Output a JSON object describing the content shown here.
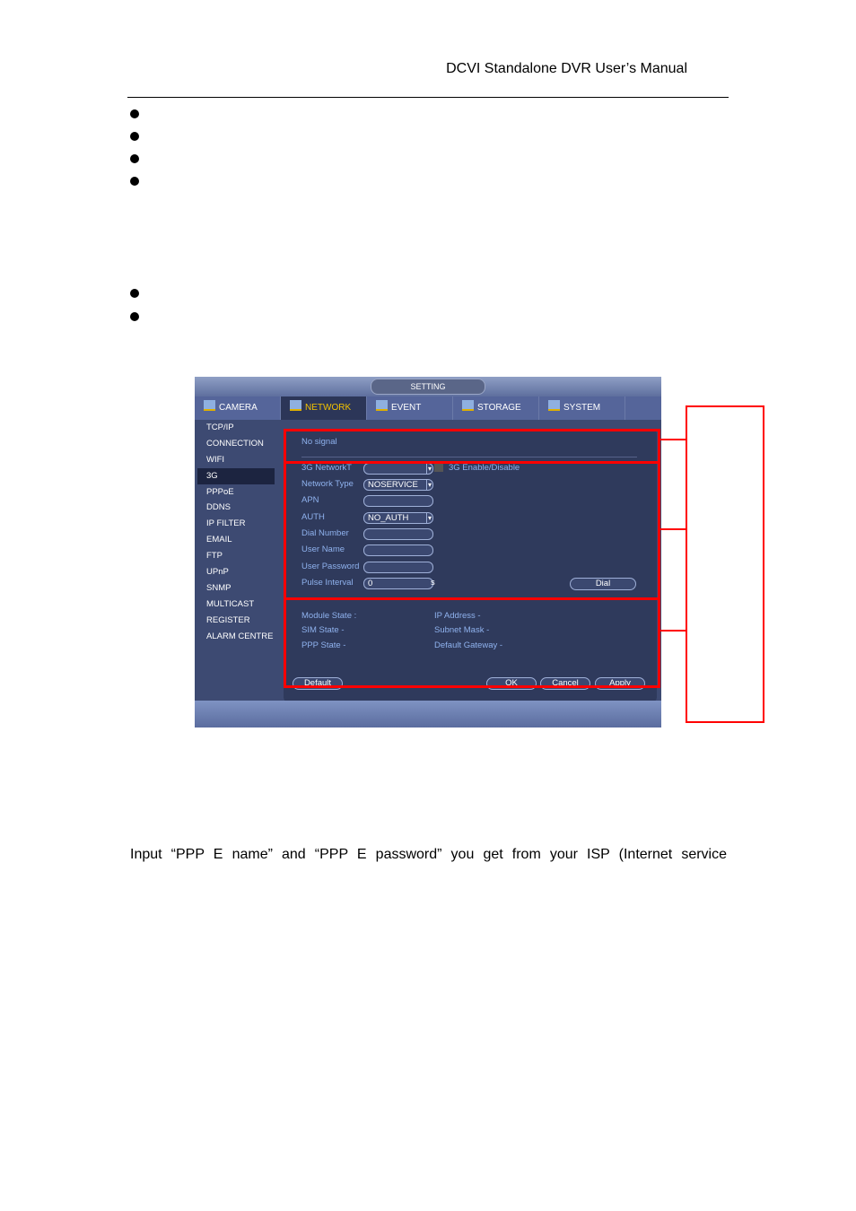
{
  "header": {
    "title": "DCVI Standalone DVR User’s Manual"
  },
  "dvr": {
    "title": "SETTING",
    "tabs": [
      {
        "label": "CAMERA",
        "icon": "camera-icon"
      },
      {
        "label": "NETWORK",
        "icon": "network-icon"
      },
      {
        "label": "EVENT",
        "icon": "event-icon"
      },
      {
        "label": "STORAGE",
        "icon": "storage-icon"
      },
      {
        "label": "SYSTEM",
        "icon": "system-icon"
      }
    ],
    "active_tab": "NETWORK",
    "sidebar": [
      "TCP/IP",
      "CONNECTION",
      "WIFI",
      "3G",
      "PPPoE",
      "DDNS",
      "IP FILTER",
      "EMAIL",
      "FTP",
      "UPnP",
      "SNMP",
      "MULTICAST",
      "REGISTER",
      "ALARM CENTRE"
    ],
    "active_side": "3G",
    "signal": "No signal",
    "form": {
      "network_label": "3G NetworkT",
      "network_value": "",
      "enable_label": "3G Enable/Disable",
      "network_type_label": "Network Type",
      "network_type_value": "NOSERVICE",
      "apn_label": "APN",
      "apn_value": "",
      "auth_label": "AUTH",
      "auth_value": "NO_AUTH",
      "dial_number_label": "Dial Number",
      "dial_number_value": "",
      "user_name_label": "User Name",
      "user_name_value": "",
      "user_password_label": "User Password",
      "user_password_value": "",
      "pulse_interval_label": "Pulse Interval",
      "pulse_interval_value": "0",
      "pulse_unit": "s",
      "dial_button": "Dial"
    },
    "status": {
      "module_state": "Module State  :",
      "sim_state": "SIM State  -",
      "ppp_state": "PPP State  -",
      "ip_address": "IP Address  -",
      "subnet_mask": "Subnet Mask  -",
      "default_gateway": "Default Gateway  -"
    },
    "buttons": {
      "default": "Default",
      "ok": "OK",
      "cancel": "Cancel",
      "apply": "Apply"
    }
  },
  "paragraph": "Input “PPP E name” and “PPP E password” you get from your ISP (Internet service"
}
